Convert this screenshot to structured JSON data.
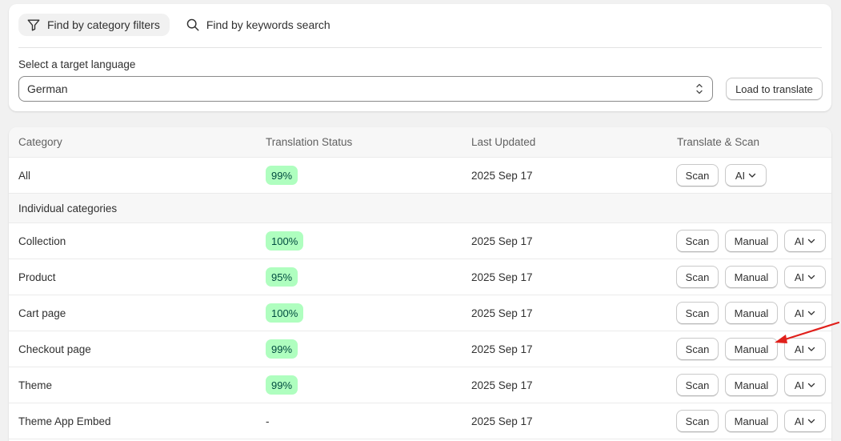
{
  "tabs": [
    {
      "label": "Find by category filters",
      "icon": "filter-icon",
      "active": true
    },
    {
      "label": "Find by keywords search",
      "icon": "search-icon",
      "active": false
    }
  ],
  "language": {
    "label": "Select a target language",
    "selected": "German",
    "load_button": "Load to translate"
  },
  "table": {
    "headers": [
      "Category",
      "Translation Status",
      "Last Updated",
      "Translate & Scan"
    ],
    "all_row": {
      "category": "All",
      "status": "99%",
      "updated": "2025 Sep 17",
      "scan": "Scan",
      "ai": "AI"
    },
    "section_label": "Individual categories",
    "rows": [
      {
        "category": "Collection",
        "status": "100%",
        "updated": "2025 Sep 17"
      },
      {
        "category": "Product",
        "status": "95%",
        "updated": "2025 Sep 17"
      },
      {
        "category": "Cart page",
        "status": "100%",
        "updated": "2025 Sep 17"
      },
      {
        "category": "Checkout page",
        "status": "99%",
        "updated": "2025 Sep 17"
      },
      {
        "category": "Theme",
        "status": "99%",
        "updated": "2025 Sep 17"
      },
      {
        "category": "Theme App Embed",
        "status": "-",
        "updated": "2025 Sep 17"
      }
    ],
    "buttons": {
      "scan": "Scan",
      "manual": "Manual",
      "ai": "AI"
    }
  },
  "colors": {
    "badge_bg": "#affebf",
    "badge_text": "#014b40",
    "annotation_arrow": "#e0201b"
  }
}
